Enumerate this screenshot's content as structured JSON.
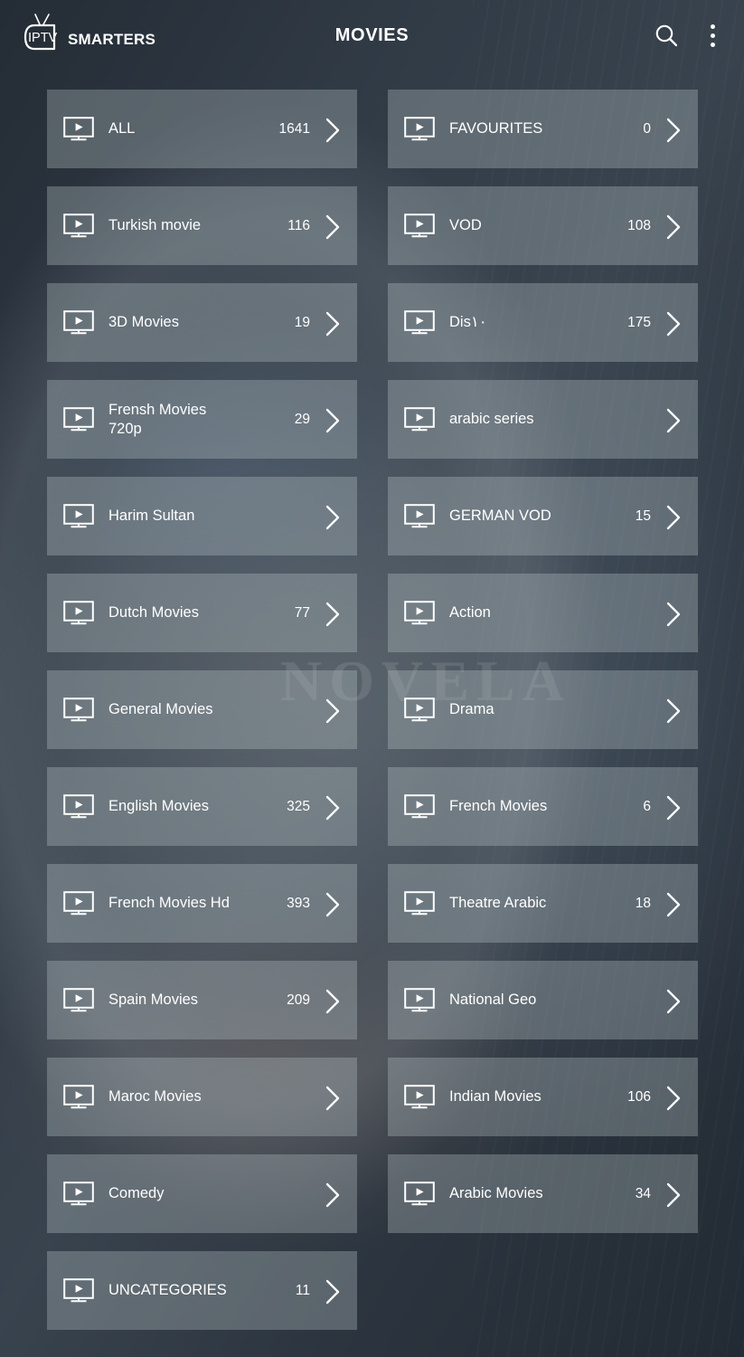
{
  "header": {
    "logo_text": "SMARTERS",
    "logo_tv_text": "IPTV",
    "logo_icon": "tv-antenna-icon",
    "title": "MOVIES",
    "search_icon": "search-icon",
    "overflow_icon": "more-vertical-icon"
  },
  "background": {
    "watermark_text": "NOVELA",
    "page_bg": "#2e3741",
    "card_bg": "rgba(182,194,196,0.34)",
    "text_color": "#ffffff"
  },
  "card_icons": {
    "leading": "tv-play-icon",
    "trailing": "chevron-right-icon"
  },
  "categories": {
    "left": [
      {
        "label": "ALL",
        "count": "1641"
      },
      {
        "label": "Turkish movie",
        "count": "116"
      },
      {
        "label": "3D Movies",
        "count": "19"
      },
      {
        "label": "Frensh Movies\n720p",
        "count": "29"
      },
      {
        "label": "Harim Sultan",
        "count": ""
      },
      {
        "label": "Dutch Movies",
        "count": "77"
      },
      {
        "label": "General Movies",
        "count": ""
      },
      {
        "label": "English Movies",
        "count": "325"
      },
      {
        "label": "French Movies Hd",
        "count": "393"
      },
      {
        "label": "Spain Movies",
        "count": "209"
      },
      {
        "label": "Maroc Movies",
        "count": ""
      },
      {
        "label": "Comedy",
        "count": ""
      },
      {
        "label": "UNCATEGORIES",
        "count": "11"
      }
    ],
    "right": [
      {
        "label": "FAVOURITES",
        "count": "0"
      },
      {
        "label": "VOD",
        "count": "108"
      },
      {
        "label": "Dis١٠",
        "count": "175"
      },
      {
        "label": "arabic series",
        "count": ""
      },
      {
        "label": "GERMAN VOD",
        "count": "15"
      },
      {
        "label": "Action",
        "count": ""
      },
      {
        "label": "Drama",
        "count": ""
      },
      {
        "label": "French Movies",
        "count": "6"
      },
      {
        "label": "Theatre Arabic",
        "count": "18"
      },
      {
        "label": "National Geo",
        "count": ""
      },
      {
        "label": "Indian Movies",
        "count": "106"
      },
      {
        "label": "Arabic Movies",
        "count": "34"
      }
    ]
  }
}
